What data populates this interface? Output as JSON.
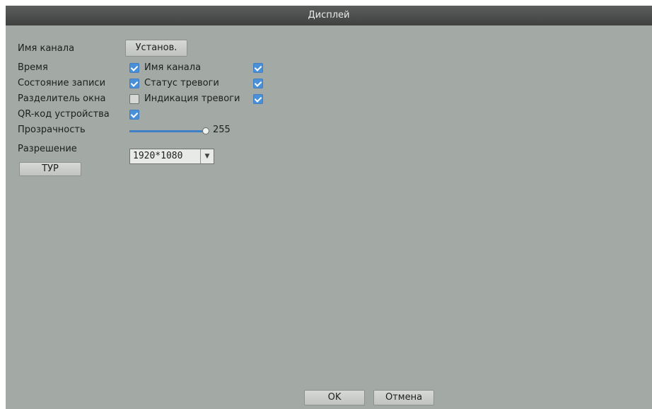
{
  "window": {
    "title": "Дисплей"
  },
  "channel_name": {
    "label": "Имя канала",
    "button": "Установ."
  },
  "options": {
    "time": {
      "label": "Время",
      "checked": true
    },
    "channel_name": {
      "label": "Имя канала",
      "checked": true
    },
    "record_state": {
      "label": "Состояние записи",
      "checked": true
    },
    "alarm_status": {
      "label": "Статус тревоги",
      "checked": true
    },
    "window_divider": {
      "label": "Разделитель окна",
      "checked": false
    },
    "alarm_indication": {
      "label": "Индикация тревоги",
      "checked": true
    },
    "device_qr": {
      "label": "QR-код устройства",
      "checked": true
    }
  },
  "transparency": {
    "label": "Прозрачность",
    "value": "255"
  },
  "resolution": {
    "label": "Разрешение",
    "value": "1920*1080"
  },
  "tour_button": "ТУР",
  "footer": {
    "ok": "OK",
    "cancel": "Отмена"
  },
  "colors": {
    "accent": "#4a90d9",
    "background": "#a3a9a4",
    "titlebar": "#4b4d4c"
  },
  "icons": {
    "checkbox": "checkmark-icon",
    "dropdown": "chevron-down-icon"
  }
}
